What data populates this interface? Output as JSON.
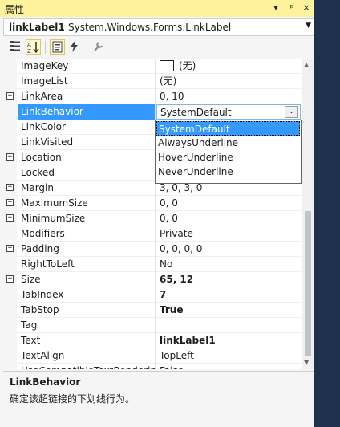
{
  "title": "属性",
  "title_buttons": [
    "▾",
    "ᵖ",
    "×"
  ],
  "object": {
    "name": "linkLabel1",
    "type": "System.Windows.Forms.LinkLabel"
  },
  "properties": [
    {
      "name": "ImageKey",
      "value": "(无)",
      "swatch": true
    },
    {
      "name": "ImageList",
      "value": "(无)"
    },
    {
      "name": "LinkArea",
      "value": "0, 10",
      "expand": true
    },
    {
      "name": "LinkBehavior",
      "value": "SystemDefault",
      "selected": true
    },
    {
      "name": "LinkColor",
      "value": ""
    },
    {
      "name": "LinkVisited",
      "value": ""
    },
    {
      "name": "Location",
      "value": "",
      "expand": true
    },
    {
      "name": "Locked",
      "value": ""
    },
    {
      "name": "Margin",
      "value": "3, 0, 3, 0",
      "expand": true
    },
    {
      "name": "MaximumSize",
      "value": "0, 0",
      "expand": true
    },
    {
      "name": "MinimumSize",
      "value": "0, 0",
      "expand": true
    },
    {
      "name": "Modifiers",
      "value": "Private"
    },
    {
      "name": "Padding",
      "value": "0, 0, 0, 0",
      "expand": true
    },
    {
      "name": "RightToLeft",
      "value": "No"
    },
    {
      "name": "Size",
      "value": "65, 12",
      "expand": true,
      "bold": true
    },
    {
      "name": "TabIndex",
      "value": "7",
      "bold": true
    },
    {
      "name": "TabStop",
      "value": "True",
      "bold": true
    },
    {
      "name": "Tag",
      "value": ""
    },
    {
      "name": "Text",
      "value": "linkLabel1",
      "bold": true
    },
    {
      "name": "TextAlign",
      "value": "TopLeft"
    },
    {
      "name": "UseCompatibleTextRendering",
      "value": "False"
    }
  ],
  "dropdown_options": [
    "SystemDefault",
    "AlwaysUnderline",
    "HoverUnderline",
    "NeverUnderline"
  ],
  "description": {
    "title": "LinkBehavior",
    "text": "确定该超链接的下划线行为。"
  },
  "colors": {
    "titlebar": "#fff29d",
    "selection": "#3399ff",
    "background": "#1e2b47"
  }
}
